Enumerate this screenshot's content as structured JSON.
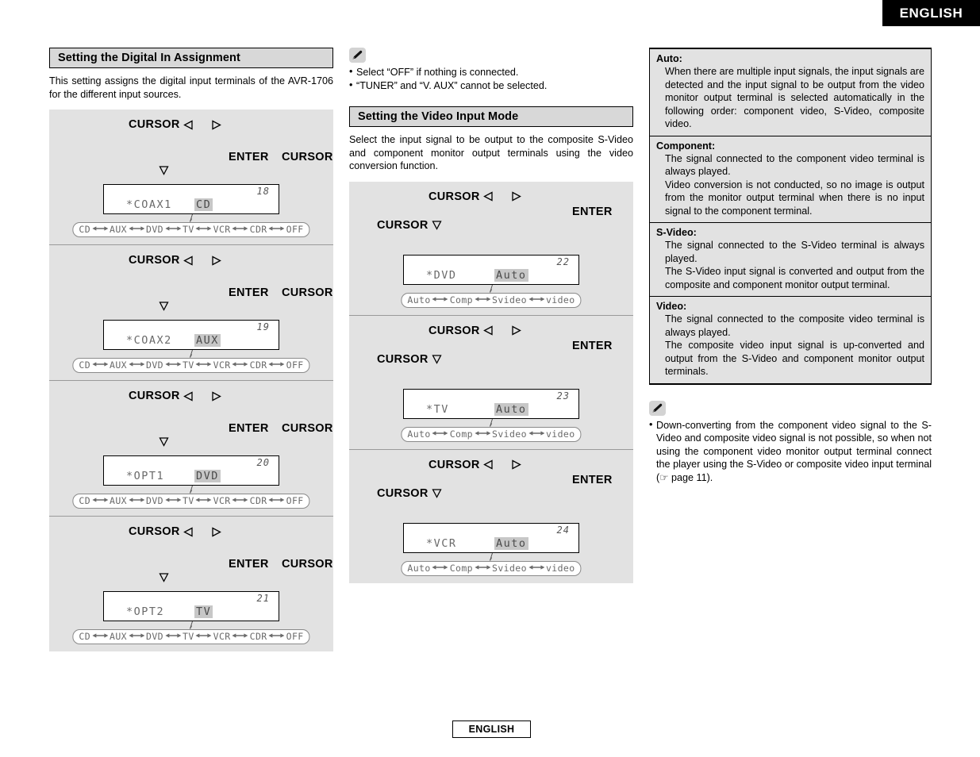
{
  "header": {
    "language_tab": "ENGLISH"
  },
  "footer": {
    "language_tab": "ENGLISH"
  },
  "left_column": {
    "heading": "Setting the Digital In Assignment",
    "intro": "This setting assigns the digital input terminals of the AVR-1706 for the different input sources.",
    "keys": {
      "cursor": "CURSOR",
      "enter": "ENTER",
      "left_icon": "cursor-left-triangle-icon",
      "right_icon": "cursor-right-triangle-icon",
      "down_icon": "cursor-down-triangle-icon"
    },
    "option_cycle": [
      "CD",
      "AUX",
      "DVD",
      "TV",
      "VCR",
      "CDR",
      "OFF"
    ],
    "steps": [
      {
        "number": "18",
        "source": "*COAX1",
        "value": "CD"
      },
      {
        "number": "19",
        "source": "*COAX2",
        "value": "AUX"
      },
      {
        "number": "20",
        "source": "*OPT1",
        "value": "DVD"
      },
      {
        "number": "21",
        "source": "*OPT2",
        "value": "TV"
      }
    ]
  },
  "middle_column": {
    "note": {
      "icon": "pencil-icon",
      "items": [
        "Select “OFF” if nothing is connected.",
        "“TUNER” and “V. AUX” cannot be selected."
      ]
    },
    "heading": "Setting the Video Input Mode",
    "intro": "Select the input signal to be output to the composite S-Video and component monitor output terminals using the video conversion function.",
    "keys": {
      "cursor": "CURSOR",
      "enter": "ENTER"
    },
    "option_cycle": [
      "Auto",
      "Comp",
      "Svideo",
      "video"
    ],
    "steps": [
      {
        "number": "22",
        "source": "*DVD",
        "value": "Auto"
      },
      {
        "number": "23",
        "source": "*TV",
        "value": "Auto"
      },
      {
        "number": "24",
        "source": "*VCR",
        "value": "Auto"
      }
    ]
  },
  "right_column": {
    "definitions": [
      {
        "term": "Auto:",
        "paragraphs": [
          "When there are multiple input signals, the input signals are detected and the input signal to be output from the video monitor output terminal is selected automatically in the following order: component video, S-Video, composite video."
        ]
      },
      {
        "term": "Component:",
        "paragraphs": [
          "The signal connected to the component video terminal is always played.",
          "Video conversion is not conducted, so no image is output from the monitor output terminal when there is no input signal to the component terminal."
        ]
      },
      {
        "term": "S-Video:",
        "paragraphs": [
          "The signal connected to the S-Video terminal is always played.",
          "The S-Video input signal is converted and output from the composite and component monitor output terminal."
        ]
      },
      {
        "term": "Video:",
        "paragraphs": [
          "The signal connected to the composite video terminal is always played.",
          "The composite video input signal is up-converted and output from the S-Video and component monitor output terminals."
        ]
      }
    ],
    "note": {
      "icon": "pencil-icon",
      "items": [
        "Down-converting from the component video signal to the S-Video and composite video signal is not possible, so when not using the component video monitor output terminal connect the player using the S-Video or composite video input terminal (☞ page 11)."
      ]
    }
  }
}
